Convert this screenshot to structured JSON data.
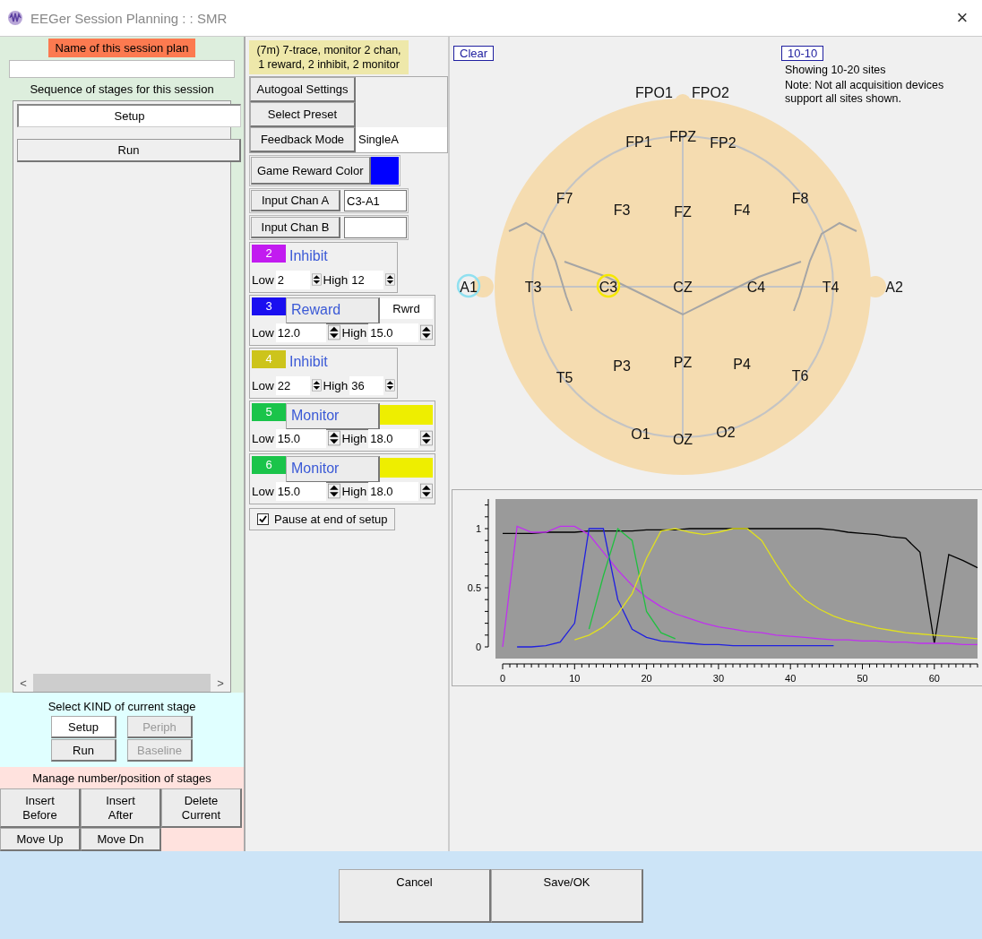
{
  "window": {
    "title": "EEGer Session Planning : : SMR",
    "close": "×"
  },
  "left_panel": {
    "name_label": "Name of this session plan",
    "sequence_label": "Sequence of stages for this session",
    "stages": [
      {
        "label": "Setup",
        "selected": true
      },
      {
        "label": "Run",
        "selected": false
      }
    ],
    "scroll_left": "<",
    "scroll_right": ">",
    "kind_label": "Select KIND of current stage",
    "kind_buttons": [
      {
        "label": "Setup",
        "selected": true,
        "disabled": false
      },
      {
        "label": "Periph",
        "selected": false,
        "disabled": true
      },
      {
        "label": "Run",
        "selected": false,
        "disabled": false
      },
      {
        "label": "Baseline",
        "selected": false,
        "disabled": true
      }
    ],
    "manage_label": "Manage number/position of stages",
    "manage_buttons": [
      "Insert\nBefore",
      "Insert\nAfter",
      "Delete\nCurrent",
      "Move Up",
      "Move Dn"
    ]
  },
  "settings_panel": {
    "description": "(7m) 7-trace, monitor 2 chan, 1 reward, 2 inhibit, 2 monitor",
    "autogoal_button": "Autogoal Settings",
    "preset_button": "Select Preset",
    "feedback_button": "Feedback Mode",
    "feedback_value": "SingleA",
    "reward_color_button": "Game Reward Color",
    "reward_swatch": {
      "color": "#0000ff"
    },
    "input_a_button": "Input Chan A",
    "input_a_value": "C3-A1",
    "input_b_button": "Input Chan B",
    "bands": [
      {
        "kind": "inhibit",
        "number": "2",
        "color": "#c21bf0",
        "label": "Inhibit",
        "low_label": "Low",
        "low": "2",
        "high_label": "High",
        "high": "12"
      },
      {
        "kind": "reward",
        "number": "3",
        "color": "#1a0ff0",
        "label": "Reward",
        "tag": "Rwrd",
        "low_label": "Low",
        "low": "12.0",
        "high_label": "High",
        "high": "15.0"
      },
      {
        "kind": "inhibit",
        "number": "4",
        "color": "#cdc41b",
        "label": "Inhibit",
        "low_label": "Low",
        "low": "22",
        "high_label": "High",
        "high": "36"
      },
      {
        "kind": "monitor",
        "number": "5",
        "color": "#1ac44a",
        "label": "Monitor",
        "swatch": {
          "color": "#eeee00"
        },
        "low_label": "Low",
        "low": "15.0",
        "high_label": "High",
        "high": "18.0"
      },
      {
        "kind": "monitor",
        "number": "6",
        "color": "#1ac44a",
        "label": "Monitor",
        "swatch": {
          "color": "#eeee00"
        },
        "low_label": "Low",
        "low": "15.0",
        "high_label": "High",
        "high": "18.0"
      }
    ],
    "pause_checkbox": {
      "label": "Pause at end of setup",
      "checked": true
    }
  },
  "site_map": {
    "clear_link": "Clear",
    "mode_link": "10-10",
    "showing": "Showing 10-20 sites",
    "note": "Note: Not all acquisition devices support all sites shown.",
    "sites": [
      {
        "label": "FPO1",
        "kind": "plain"
      },
      {
        "label": "FPO2",
        "kind": "plain"
      },
      {
        "label": "FP1",
        "kind": "plain"
      },
      {
        "label": "FPZ",
        "kind": "plain"
      },
      {
        "label": "FP2",
        "kind": "plain"
      },
      {
        "label": "F7",
        "kind": "plain"
      },
      {
        "label": "F3",
        "kind": "plain"
      },
      {
        "label": "FZ",
        "kind": "plain"
      },
      {
        "label": "F4",
        "kind": "plain"
      },
      {
        "label": "F8",
        "kind": "plain"
      },
      {
        "label": "A1",
        "kind": "reference"
      },
      {
        "label": "T3",
        "kind": "plain"
      },
      {
        "label": "C3",
        "kind": "active"
      },
      {
        "label": "CZ",
        "kind": "plain"
      },
      {
        "label": "C4",
        "kind": "plain"
      },
      {
        "label": "T4",
        "kind": "plain"
      },
      {
        "label": "A2",
        "kind": "plain"
      },
      {
        "label": "T5",
        "kind": "plain"
      },
      {
        "label": "P3",
        "kind": "plain"
      },
      {
        "label": "PZ",
        "kind": "plain"
      },
      {
        "label": "P4",
        "kind": "plain"
      },
      {
        "label": "T6",
        "kind": "plain"
      },
      {
        "label": "O1",
        "kind": "plain"
      },
      {
        "label": "OZ",
        "kind": "plain"
      },
      {
        "label": "O2",
        "kind": "plain"
      }
    ]
  },
  "filter_chart": {
    "chart_data": {
      "type": "line",
      "x": [
        0,
        2,
        4,
        6,
        8,
        10,
        12,
        14,
        16,
        18,
        20,
        22,
        24,
        26,
        28,
        30,
        32,
        34,
        36,
        38,
        40,
        42,
        44,
        46,
        48,
        50,
        52,
        54,
        56,
        58,
        60,
        62,
        64,
        66
      ],
      "series": [
        {
          "color": "#000000",
          "values": [
            0.96,
            0.96,
            0.96,
            0.97,
            0.97,
            0.97,
            0.98,
            0.98,
            0.98,
            0.98,
            0.99,
            0.99,
            0.99,
            1.0,
            1.0,
            1.0,
            1.0,
            1.0,
            1.0,
            1.0,
            1.0,
            1.0,
            1.0,
            0.99,
            0.97,
            0.96,
            0.95,
            0.93,
            0.92,
            0.8,
            0.03,
            0.78,
            0.73,
            0.67
          ]
        },
        {
          "color": "#c030f0",
          "values": [
            0.0,
            1.02,
            0.97,
            0.97,
            1.02,
            1.02,
            0.95,
            0.8,
            0.65,
            0.52,
            0.42,
            0.34,
            0.28,
            0.24,
            0.2,
            0.17,
            0.15,
            0.13,
            0.12,
            0.1,
            0.09,
            0.08,
            0.07,
            0.06,
            0.06,
            0.05,
            0.05,
            0.04,
            0.04,
            0.03,
            0.03,
            0.03,
            0.02,
            0.02
          ]
        },
        {
          "color": "#2020e0",
          "values": [
            null,
            0.0,
            0.0,
            0.01,
            0.04,
            0.2,
            1.0,
            1.0,
            0.4,
            0.15,
            0.08,
            0.05,
            0.04,
            0.03,
            0.02,
            0.02,
            0.01,
            0.01,
            0.01,
            0.01,
            0.01,
            0.01,
            0.01,
            0.01,
            null,
            null,
            null,
            null,
            null,
            null,
            null,
            null,
            null,
            null
          ]
        },
        {
          "color": "#20c040",
          "values": [
            null,
            null,
            null,
            null,
            null,
            null,
            0.15,
            0.6,
            1.0,
            0.9,
            0.3,
            0.12,
            0.07,
            null,
            null,
            null,
            null,
            null,
            null,
            null,
            null,
            null,
            null,
            null,
            null,
            null,
            null,
            null,
            null,
            null,
            null,
            null,
            null,
            null
          ]
        },
        {
          "color": "#e0e020",
          "values": [
            null,
            null,
            null,
            null,
            null,
            0.06,
            0.1,
            0.17,
            0.28,
            0.45,
            0.75,
            0.98,
            1.0,
            0.97,
            0.95,
            0.97,
            1.0,
            1.0,
            0.9,
            0.7,
            0.52,
            0.4,
            0.32,
            0.26,
            0.22,
            0.19,
            0.16,
            0.14,
            0.12,
            0.11,
            0.1,
            0.09,
            0.08,
            0.07
          ]
        }
      ],
      "xlim": [
        0,
        66
      ],
      "ylim": [
        0,
        1.25
      ],
      "xticks": [
        0,
        10,
        20,
        30,
        40,
        50,
        60
      ],
      "yticks": [
        0,
        0.5,
        1
      ]
    }
  },
  "footer": {
    "buttons": [
      "Cancel",
      "Save/OK"
    ]
  }
}
